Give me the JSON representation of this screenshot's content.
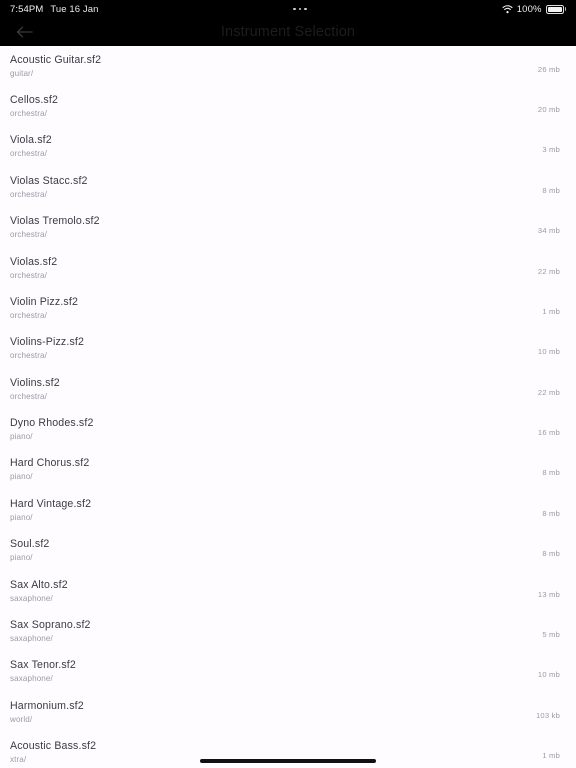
{
  "status_bar": {
    "time": "7:54PM",
    "date": "Tue 16 Jan",
    "menu_dots_icon": "three-dots-icon",
    "wifi_icon": "wifi-icon",
    "battery_percent": "100%",
    "battery_icon": "battery-full-icon"
  },
  "nav": {
    "back_icon": "arrow-left-icon",
    "title": "Instrument Selection"
  },
  "list": {
    "items": [
      {
        "name": "Acoustic Guitar.sf2",
        "folder": "guitar/",
        "size": "26 mb"
      },
      {
        "name": "Cellos.sf2",
        "folder": "orchestra/",
        "size": "20 mb"
      },
      {
        "name": "Viola.sf2",
        "folder": "orchestra/",
        "size": "3 mb"
      },
      {
        "name": "Violas Stacc.sf2",
        "folder": "orchestra/",
        "size": "8 mb"
      },
      {
        "name": "Violas Tremolo.sf2",
        "folder": "orchestra/",
        "size": "34 mb"
      },
      {
        "name": "Violas.sf2",
        "folder": "orchestra/",
        "size": "22 mb"
      },
      {
        "name": "Violin Pizz.sf2",
        "folder": "orchestra/",
        "size": "1 mb"
      },
      {
        "name": "Violins-Pizz.sf2",
        "folder": "orchestra/",
        "size": "10 mb"
      },
      {
        "name": "Violins.sf2",
        "folder": "orchestra/",
        "size": "22 mb"
      },
      {
        "name": "Dyno Rhodes.sf2",
        "folder": "piano/",
        "size": "16 mb"
      },
      {
        "name": "Hard Chorus.sf2",
        "folder": "piano/",
        "size": "8 mb"
      },
      {
        "name": "Hard Vintage.sf2",
        "folder": "piano/",
        "size": "8 mb"
      },
      {
        "name": "Soul.sf2",
        "folder": "piano/",
        "size": "8 mb"
      },
      {
        "name": "Sax Alto.sf2",
        "folder": "saxaphone/",
        "size": "13 mb"
      },
      {
        "name": "Sax Soprano.sf2",
        "folder": "saxaphone/",
        "size": "5 mb"
      },
      {
        "name": "Sax Tenor.sf2",
        "folder": "saxaphone/",
        "size": "10 mb"
      },
      {
        "name": "Harmonium.sf2",
        "folder": "world/",
        "size": "103 kb"
      },
      {
        "name": "Acoustic Bass.sf2",
        "folder": "xtra/",
        "size": "1 mb"
      }
    ]
  },
  "home_indicator": {
    "label": "home-indicator"
  },
  "colors": {
    "background": "#fffcff",
    "chrome": "#000000",
    "title_text": "#1d1d1f",
    "row_title_text": "#3a3a42",
    "row_sub_text": "#9b9ba4"
  }
}
